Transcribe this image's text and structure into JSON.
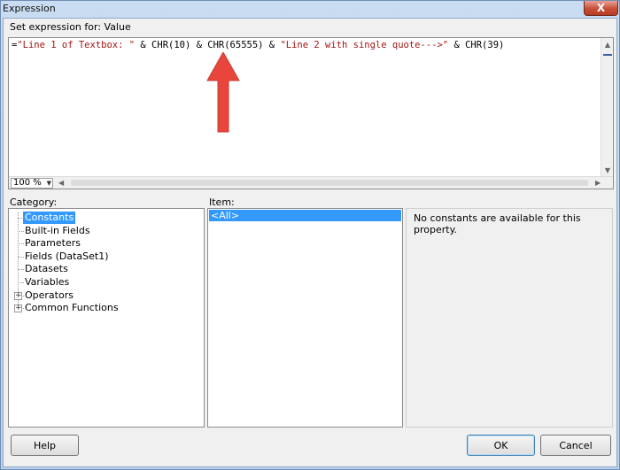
{
  "window": {
    "title": "Expression",
    "close_glyph": "X"
  },
  "editor": {
    "label": "Set expression for: Value",
    "expression_tokens": [
      {
        "text": "=",
        "kind": "op"
      },
      {
        "text": "\"Line 1 of Textbox: \"",
        "kind": "str"
      },
      {
        "text": " & CHR(10) & CHR(65555) & ",
        "kind": "op"
      },
      {
        "text": "\"Line 2 with single quote--->\"",
        "kind": "str"
      },
      {
        "text": " & CHR(39)",
        "kind": "op"
      }
    ],
    "zoom": "100 %"
  },
  "category": {
    "label": "Category:",
    "items": [
      {
        "label": "Constants",
        "selected": true,
        "expandable": false
      },
      {
        "label": "Built-in Fields",
        "selected": false,
        "expandable": false
      },
      {
        "label": "Parameters",
        "selected": false,
        "expandable": false
      },
      {
        "label": "Fields (DataSet1)",
        "selected": false,
        "expandable": false
      },
      {
        "label": "Datasets",
        "selected": false,
        "expandable": false
      },
      {
        "label": "Variables",
        "selected": false,
        "expandable": false
      },
      {
        "label": "Operators",
        "selected": false,
        "expandable": true
      },
      {
        "label": "Common Functions",
        "selected": false,
        "expandable": true
      }
    ]
  },
  "item": {
    "label": "Item:",
    "selected_value": "<All>"
  },
  "info": {
    "text": "No constants are available for this property."
  },
  "buttons": {
    "help": "Help",
    "ok": "OK",
    "cancel": "Cancel"
  },
  "colors": {
    "string_literal": "#a31515",
    "selection": "#3399ff",
    "annotation_arrow": "#e8463c"
  }
}
